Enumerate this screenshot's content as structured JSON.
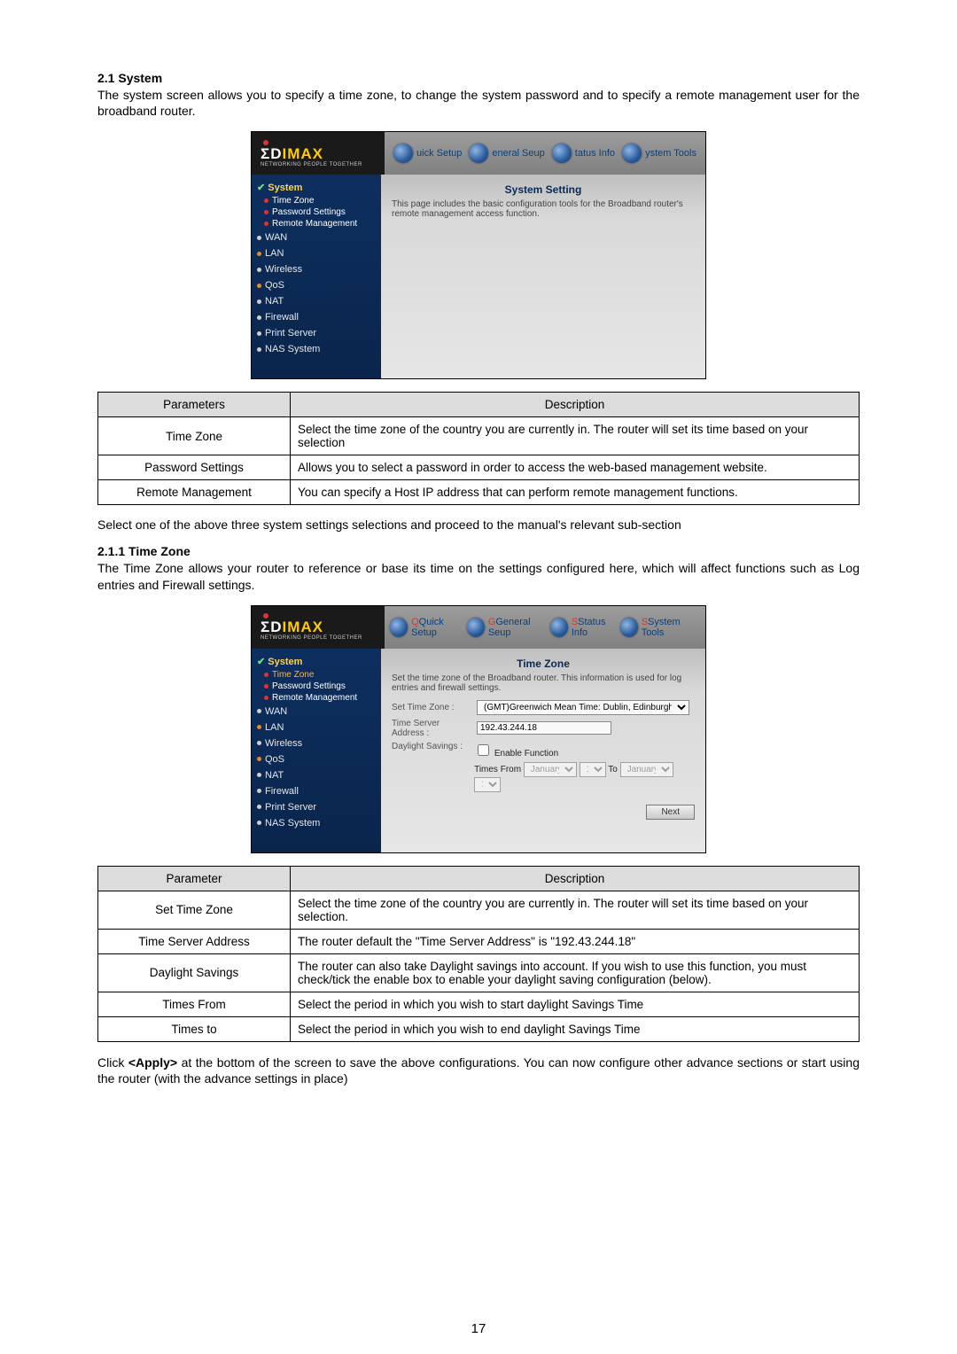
{
  "page_number": "17",
  "section1": {
    "heading": "2.1 System",
    "intro": "The system screen allows you to specify a time zone, to change the system password and to specify a remote management user for the broadband router.",
    "followup": "Select one of the above three system settings selections and proceed to the manual's relevant sub-section"
  },
  "router_common": {
    "logo_main_a": "ΣD",
    "logo_main_b": "IMAX",
    "logo_sub": "NETWORKING PEOPLE TOGETHER",
    "top_items": [
      "Quick Setup",
      "General Seup",
      "Status Info",
      "System Tools"
    ],
    "sidebar_root": "System",
    "sidebar_subs": [
      "Time Zone",
      "Password Settings",
      "Remote Management"
    ],
    "sidebar_main": [
      "WAN",
      "LAN",
      "Wireless",
      "QoS",
      "NAT",
      "Firewall",
      "Print Server",
      "NAS System"
    ]
  },
  "router1": {
    "title": "System Setting",
    "desc": "This page includes the basic configuration tools for the Broadband router's remote management access function."
  },
  "table1": {
    "h1": "Parameters",
    "h2": "Description",
    "rows": [
      {
        "p": "Time Zone",
        "d": "Select the time zone of the country you are currently in. The router will set its time based on your selection"
      },
      {
        "p": "Password Settings",
        "d": "Allows you to select a password in order to access the web-based management website."
      },
      {
        "p": "Remote Management",
        "d": "You can specify a Host IP address that can perform remote management functions."
      }
    ]
  },
  "section2": {
    "heading": "2.1.1 Time Zone",
    "intro": "The Time Zone allows your router to reference or base its time on the settings configured here, which will affect functions such as Log entries and Firewall settings."
  },
  "router2": {
    "title": "Time Zone",
    "desc": "Set the time zone of the Broadband router. This information is used for log entries and firewall settings.",
    "labels": {
      "tz": "Set Time Zone :",
      "server": "Time Server Address :",
      "ds": "Daylight Savings :",
      "enable": "Enable Function",
      "from": "Times From",
      "to": "To",
      "next": "Next"
    },
    "values": {
      "tz": "(GMT)Greenwich Mean Time: Dublin, Edinburgh, Lisbon, London",
      "server": "192.43.244.18",
      "from_month": "January",
      "from_day": "1",
      "to_month": "January",
      "to_day": "1"
    }
  },
  "table2": {
    "h1": "Parameter",
    "h2": "Description",
    "rows": [
      {
        "p": "Set Time Zone",
        "d": "Select the time zone of the country you are currently in. The router will set its time based on your selection."
      },
      {
        "p": "Time Server Address",
        "d": "The router default the \"Time Server Address\" is \"192.43.244.18\""
      },
      {
        "p": "Daylight Savings",
        "d": "The router can also take Daylight savings into account. If you wish to use this function, you must check/tick the enable box to enable your daylight saving configuration (below)."
      },
      {
        "p": "Times From",
        "d": "Select the period in which you wish to start daylight Savings Time"
      },
      {
        "p": "Times to",
        "d": "Select the period in which you wish to end daylight Savings Time"
      }
    ]
  },
  "closing": {
    "pre": "Click ",
    "apply": "<Apply>",
    "post": " at the bottom of the screen to save the above configurations. You can now configure other advance sections or start using the router (with the advance settings in place)"
  }
}
